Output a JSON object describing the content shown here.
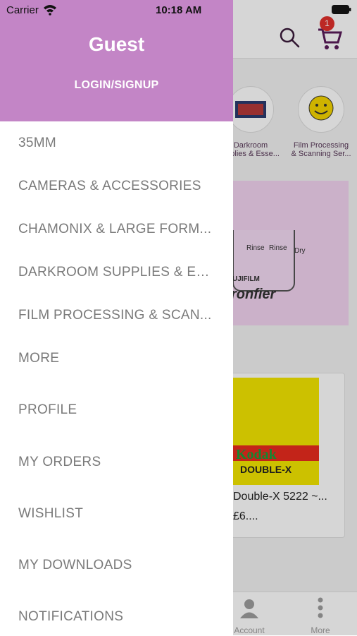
{
  "status_bar": {
    "carrier": "Carrier",
    "time": "10:18 AM"
  },
  "header": {
    "user": "Guest",
    "login_label": "LOGIN/SIGNUP"
  },
  "menu": [
    {
      "label": "35MM"
    },
    {
      "label": "CAMERAS & ACCESSORIES"
    },
    {
      "label": "CHAMONIX & LARGE FORM..."
    },
    {
      "label": "DARKROOM SUPPLIES & ES..."
    },
    {
      "label": "FILM PROCESSING & SCAN..."
    },
    {
      "label": "MORE"
    },
    {
      "label": "PROFILE"
    },
    {
      "label": "MY ORDERS"
    },
    {
      "label": "WISHLIST"
    },
    {
      "label": "MY DOWNLOADS"
    },
    {
      "label": "NOTIFICATIONS"
    }
  ],
  "background": {
    "cart_badge": "1",
    "categories": [
      {
        "label": "Darkroom\nupplies & Esse..."
      },
      {
        "label": "Film Processing\n& Scanning Ser..."
      }
    ],
    "banner": {
      "brand": "ronfier",
      "fuji": "UJIFILM",
      "rinse1": "Rinse",
      "rinse2": "Rinse",
      "dry": "Dry"
    },
    "product": {
      "title": "Double-X 5222 ~...",
      "price": "£6....",
      "film_brand": "Kodak",
      "film_name": "DOUBLE-X"
    },
    "tabs": [
      {
        "label": "Account"
      },
      {
        "label": "More"
      }
    ]
  },
  "colors": {
    "drawer_header": "#c385c6",
    "menu_text": "#7a7a7a",
    "badge": "#e0302b"
  }
}
